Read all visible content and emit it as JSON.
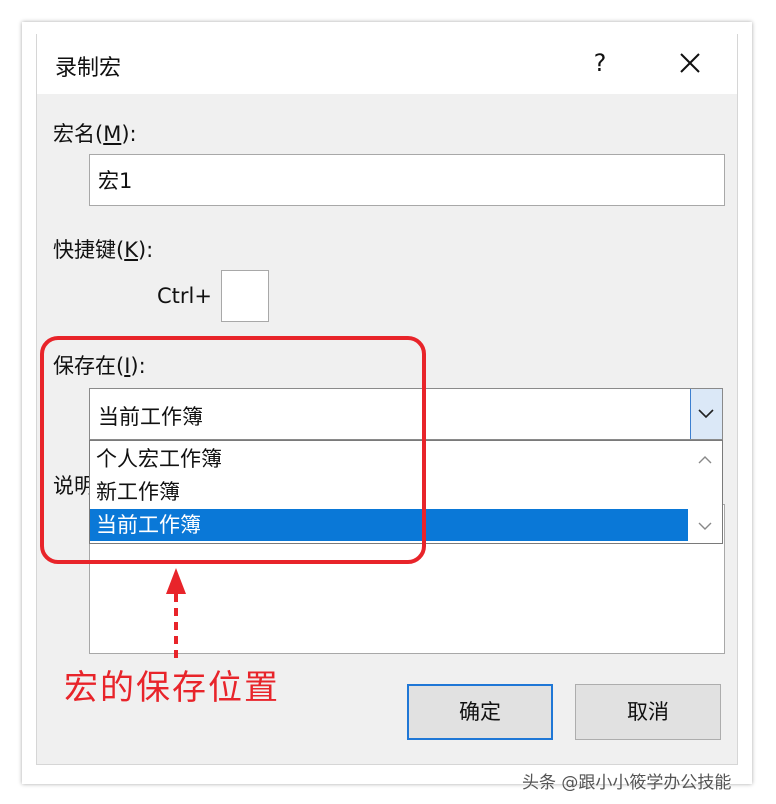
{
  "dialog": {
    "title": "录制宏",
    "help_glyph": "?",
    "macro_name_label": "宏名",
    "macro_name_key": "M",
    "macro_name_value": "宏1",
    "shortcut_label": "快捷键",
    "shortcut_key": "K",
    "ctrl_label": "Ctrl+",
    "shortcut_value": "",
    "store_in_label": "保存在",
    "store_in_key": "I",
    "store_in_value": "当前工作簿",
    "store_in_options": [
      "个人宏工作簿",
      "新工作簿",
      "当前工作簿"
    ],
    "description_label_partial": "说明",
    "description_value": "",
    "ok_label": "确定",
    "cancel_label": "取消"
  },
  "annotation": {
    "text": "宏的保存位置",
    "color": "#e8242a"
  },
  "watermark": "头条 @跟小小筱学办公技能",
  "colors": {
    "selection": "#0a78d7",
    "default_button_border": "#1f77d6",
    "annotation_red": "#e8242a"
  }
}
